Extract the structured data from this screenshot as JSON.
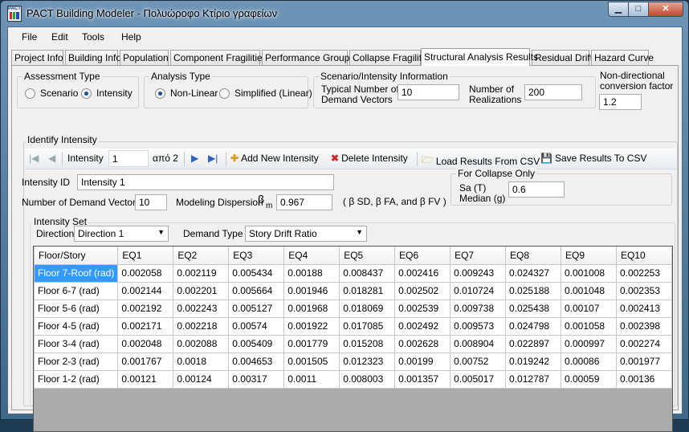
{
  "window": {
    "title": "PACT Building Modeler - Πολυώροφο Κτίριο γραφείων",
    "icon_text": "PACT"
  },
  "menu": [
    "File",
    "Edit",
    "Tools",
    "Help"
  ],
  "tabs": [
    "Project Info",
    "Building Info",
    "Population",
    "Component Fragilities",
    "Performance Groups",
    "Collapse Fragility",
    "Structural Analysis Results",
    "Residual Drift",
    "Hazard Curve"
  ],
  "active_tab": "Structural Analysis Results",
  "assessment_type": {
    "label": "Assessment Type",
    "options": [
      "Scenario",
      "Intensity"
    ],
    "selected": "Intensity"
  },
  "analysis_type": {
    "label": "Analysis Type",
    "options": [
      "Non-Linear",
      "Simplified (Linear)"
    ],
    "selected": "Non-Linear"
  },
  "scenario_info": {
    "label": "Scenario/Intensity Information",
    "demand_vectors_label_1": "Typical Number of",
    "demand_vectors_label_2": "Demand Vectors",
    "demand_vectors_value": "10",
    "realizations_label_1": "Number of",
    "realizations_label_2": "Realizations",
    "realizations_value": "200"
  },
  "nondirectional": {
    "label_1": "Non-directional",
    "label_2": "conversion factor",
    "value": "1.2"
  },
  "identify_intensity": {
    "label": "Identify Intensity",
    "toolbar": {
      "intensity_label": "Intensity",
      "current": "1",
      "of_total": "από 2",
      "add": "Add New Intensity",
      "delete": "Delete Intensity",
      "load": "Load Results From CSV",
      "save": "Save Results To CSV"
    },
    "intensity_id_label": "Intensity ID",
    "intensity_id_value": "Intensity 1",
    "num_demand_vectors_label": "Number of Demand Vectors",
    "num_demand_vectors_value": "10",
    "modeling_dispersion_label": "Modeling Dispersion",
    "beta_symbol": "β",
    "beta_sub": "m",
    "modeling_dispersion_value": "0.967",
    "beta_note": "( β SD, β FA, and β FV )"
  },
  "collapse_only": {
    "label": "For Collapse Only",
    "sa_label": "Sa (T)",
    "median_label": "Median (g)",
    "value": "0.6"
  },
  "intensity_set": {
    "label": "Intensity Set",
    "direction_label": "Direction",
    "direction_value": "Direction 1",
    "demand_type_label": "Demand Type",
    "demand_type_value": "Story Drift Ratio"
  },
  "grid": {
    "columns": [
      "Floor/Story",
      "EQ1",
      "EQ2",
      "EQ3",
      "EQ4",
      "EQ5",
      "EQ6",
      "EQ7",
      "EQ8",
      "EQ9",
      "EQ10"
    ],
    "rows": [
      [
        "Floor 7-Roof (rad)",
        "0.002058",
        "0.002119",
        "0.005434",
        "0.00188",
        "0.008437",
        "0.002416",
        "0.009243",
        "0.024327",
        "0.001008",
        "0.002253"
      ],
      [
        "Floor 6-7 (rad)",
        "0.002144",
        "0.002201",
        "0.005664",
        "0.001946",
        "0.018281",
        "0.002502",
        "0.010724",
        "0.025188",
        "0.001048",
        "0.002353"
      ],
      [
        "Floor 5-6 (rad)",
        "0.002192",
        "0.002243",
        "0.005127",
        "0.001968",
        "0.018069",
        "0.002539",
        "0.009738",
        "0.025438",
        "0.00107",
        "0.002413"
      ],
      [
        "Floor 4-5 (rad)",
        "0.002171",
        "0.002218",
        "0.00574",
        "0.001922",
        "0.017085",
        "0.002492",
        "0.009573",
        "0.024798",
        "0.001058",
        "0.002398"
      ],
      [
        "Floor 3-4 (rad)",
        "0.002048",
        "0.002088",
        "0.005409",
        "0.001779",
        "0.015208",
        "0.002628",
        "0.008904",
        "0.022897",
        "0.000997",
        "0.002274"
      ],
      [
        "Floor 2-3 (rad)",
        "0.001767",
        "0.0018",
        "0.004653",
        "0.001505",
        "0.012323",
        "0.00199",
        "0.00752",
        "0.019242",
        "0.00086",
        "0.001977"
      ],
      [
        "Floor 1-2 (rad)",
        "0.00121",
        "0.00124",
        "0.00317",
        "0.0011",
        "0.008003",
        "0.001357",
        "0.005017",
        "0.012787",
        "0.00059",
        "0.00136"
      ]
    ],
    "selected_row": 0
  }
}
